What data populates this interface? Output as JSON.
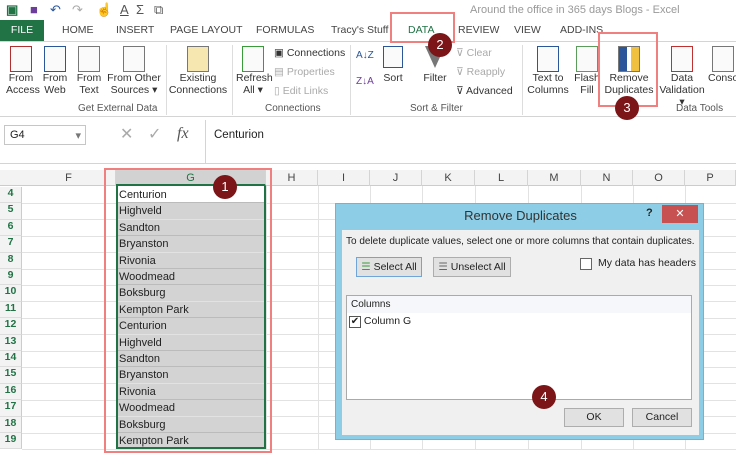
{
  "window": {
    "title": "Around the office in 365 days Blogs - Excel"
  },
  "tabs": [
    "FILE",
    "HOME",
    "INSERT",
    "PAGE LAYOUT",
    "FORMULAS",
    "Tracy's Stuff",
    "DATA",
    "REVIEW",
    "VIEW",
    "ADD-INS"
  ],
  "active_tab": "DATA",
  "ribbon": {
    "get_external": {
      "from_access": [
        "From",
        "Access"
      ],
      "from_web": [
        "From",
        "Web"
      ],
      "from_text": [
        "From",
        "Text"
      ],
      "from_other": [
        "From Other",
        "Sources ▾"
      ],
      "existing": [
        "Existing",
        "Connections"
      ],
      "label": "Get External Data"
    },
    "connections": {
      "refresh": [
        "Refresh",
        "All ▾"
      ],
      "connections": "Connections",
      "properties": "Properties",
      "edit_links": "Edit Links",
      "label": "Connections"
    },
    "sort_filter": {
      "sort": "Sort",
      "filter": "Filter",
      "clear": "Clear",
      "reapply": "Reapply",
      "advanced": "Advanced",
      "label": "Sort & Filter"
    },
    "data_tools": {
      "text_to_columns": [
        "Text to",
        "Columns"
      ],
      "flash_fill": [
        "Flash",
        "Fill"
      ],
      "remove_duplicates": [
        "Remove",
        "Duplicates"
      ],
      "data_validation": [
        "Data",
        "Validation ▾"
      ],
      "consolidate": "Conso",
      "label": "Data Tools"
    }
  },
  "formula_bar": {
    "name_box": "G4",
    "fx": "fx",
    "value": "Centurion"
  },
  "columns": [
    "F",
    "G",
    "H",
    "I",
    "J",
    "K",
    "L",
    "M",
    "N",
    "O",
    "P"
  ],
  "rows": [
    {
      "n": "4",
      "v": "Centurion"
    },
    {
      "n": "5",
      "v": "Highveld"
    },
    {
      "n": "6",
      "v": "Sandton"
    },
    {
      "n": "7",
      "v": "Bryanston"
    },
    {
      "n": "8",
      "v": "Rivonia"
    },
    {
      "n": "9",
      "v": "Woodmead"
    },
    {
      "n": "10",
      "v": "Boksburg"
    },
    {
      "n": "11",
      "v": "Kempton Park"
    },
    {
      "n": "12",
      "v": "Centurion"
    },
    {
      "n": "13",
      "v": "Highveld"
    },
    {
      "n": "14",
      "v": "Sandton"
    },
    {
      "n": "15",
      "v": "Bryanston"
    },
    {
      "n": "16",
      "v": "Rivonia"
    },
    {
      "n": "17",
      "v": "Woodmead"
    },
    {
      "n": "18",
      "v": "Boksburg"
    },
    {
      "n": "19",
      "v": "Kempton Park"
    }
  ],
  "dialog": {
    "title": "Remove Duplicates",
    "help": "?",
    "close": "✕",
    "instruction": "To delete duplicate values, select one or more columns that contain duplicates.",
    "select_all": "Select All",
    "unselect_all": "Unselect All",
    "headers_label": "My data has headers",
    "headers_checked": false,
    "columns_header": "Columns",
    "column_items": [
      {
        "label": "Column G",
        "checked": true
      }
    ],
    "ok": "OK",
    "cancel": "Cancel"
  },
  "callouts": [
    "1",
    "2",
    "3",
    "4"
  ],
  "colors": {
    "excel_green": "#217346",
    "callout": "#7b1518",
    "highlight": "#f08080",
    "dialog_frame": "#8dcde5"
  }
}
